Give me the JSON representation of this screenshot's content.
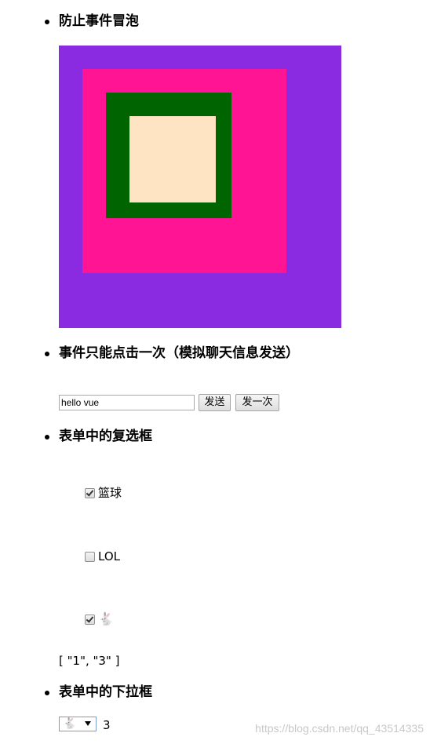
{
  "sections": {
    "bubble": {
      "heading": "防止事件冒泡"
    },
    "once": {
      "heading": "事件只能点击一次（模拟聊天信息发送）"
    },
    "checkbox": {
      "heading": "表单中的复选框"
    },
    "select": {
      "heading": "表单中的下拉框"
    }
  },
  "nested_boxes": {
    "outer_color": "#8a2be2",
    "pink_color": "#ff1493",
    "green_color": "#006400",
    "inner_color": "#ffe4c4"
  },
  "message": {
    "input_value": "hello vue",
    "send_label": "发送",
    "send_once_label": "发一次"
  },
  "checkboxes": [
    {
      "label": "篮球",
      "checked": true
    },
    {
      "label": "LOL",
      "checked": false
    },
    {
      "label": "🐇",
      "checked": true
    }
  ],
  "checked_values_text": "[ \"1\", \"3\" ]",
  "dropdown": {
    "selected_label": "🐇",
    "selected_value": "3"
  },
  "watermark": "https://blog.csdn.net/qq_43514335"
}
